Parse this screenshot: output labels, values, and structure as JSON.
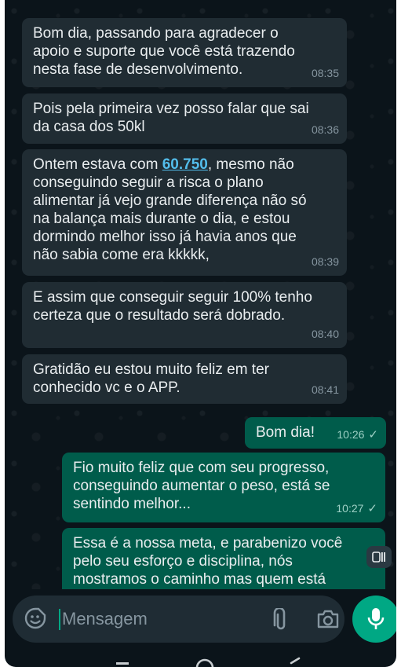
{
  "messages": [
    {
      "direction": "in",
      "text": "Bom dia, passando para agradecer o\napoio e suporte que você está trazendo\nnesta fase de desenvolvimento.",
      "time": "08:35"
    },
    {
      "direction": "in",
      "text": "Pois pela primeira vez posso falar que sai\nda casa dos 50kl",
      "time": "08:36"
    },
    {
      "direction": "in",
      "text_before": "Ontem estava com ",
      "link": "60.750",
      "text_after": ", mesmo não\nconseguindo seguir a risca o plano\nalimentar já vejo grande diferença não só\nna balança mais durante o dia, e estou\ndormindo melhor isso já havia anos que\nnão sabia come era kkkkk,",
      "time": "08:39"
    },
    {
      "direction": "in",
      "text": "E assim que conseguir seguir 100% tenho\ncerteza que o resultado será dobrado.",
      "time": "08:40"
    },
    {
      "direction": "in",
      "text": "Gratidão eu estou muito feliz em ter\nconhecido vc e o APP.",
      "time": "08:41"
    },
    {
      "direction": "out",
      "text": "Bom dia!",
      "time": "10:26"
    },
    {
      "direction": "out",
      "text": "Fio muito feliz que com seu progresso,\nconseguindo aumentar o peso, está se\nsentindo melhor...",
      "time": "10:27"
    },
    {
      "direction": "out",
      "text": "Essa é a nossa meta, e parabenizo você\npelo seu esforço e disciplina, nós\nmostramos o caminho mas quem está"
    }
  ],
  "composer": {
    "placeholder": "Mensagem"
  },
  "icons": {
    "emoji": "sticker-emoji-icon",
    "attach": "paperclip-icon",
    "camera": "camera-icon",
    "mic": "microphone-icon",
    "toggle": "view-toggle-icon",
    "read_receipt": "check-icon"
  },
  "colors": {
    "background": "#0b141a",
    "incoming_bubble": "#202c33",
    "outgoing_bubble": "#005c4b",
    "accent": "#00a884",
    "link": "#53bdeb"
  }
}
